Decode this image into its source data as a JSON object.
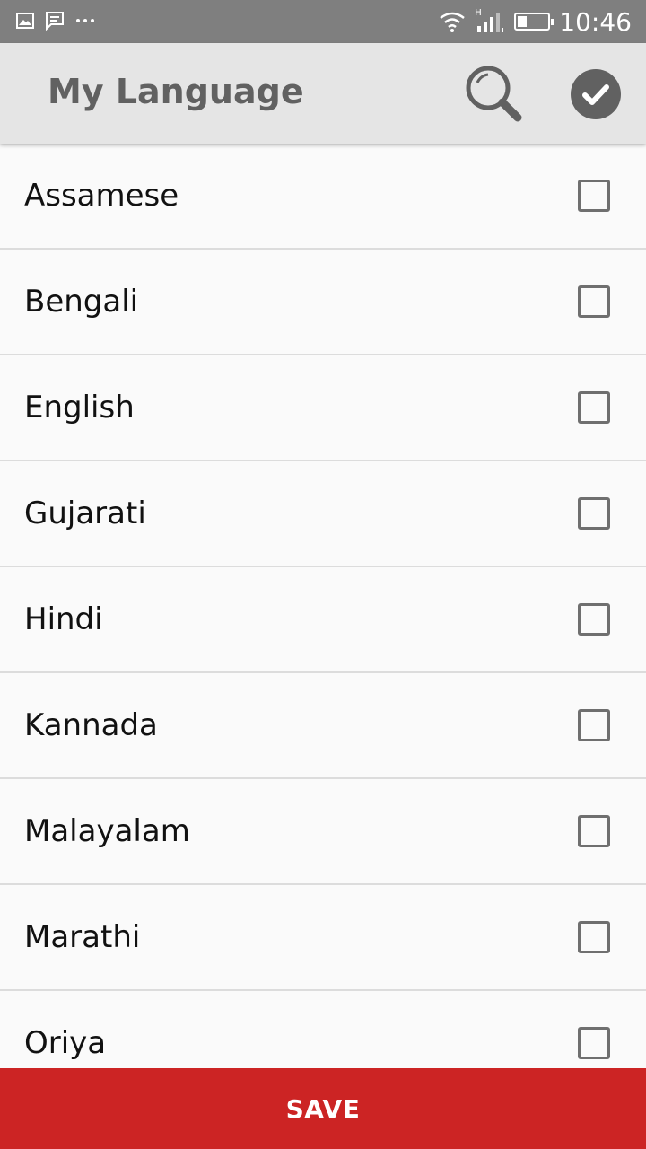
{
  "status_bar": {
    "time": "10:46",
    "icons": [
      "gallery-icon",
      "message-icon",
      "more-dots-icon",
      "wifi-icon",
      "signal-icon",
      "battery-icon"
    ],
    "battery_level": 0.3,
    "network_label": "H"
  },
  "app_bar": {
    "title": "My Language",
    "search_icon": "search-icon",
    "done_icon": "check-circle-icon"
  },
  "languages": [
    {
      "label": "Assamese",
      "checked": false
    },
    {
      "label": "Bengali",
      "checked": false
    },
    {
      "label": "English",
      "checked": false
    },
    {
      "label": "Gujarati",
      "checked": false
    },
    {
      "label": "Hindi",
      "checked": false
    },
    {
      "label": "Kannada",
      "checked": false
    },
    {
      "label": "Malayalam",
      "checked": false
    },
    {
      "label": "Marathi",
      "checked": false
    },
    {
      "label": "Oriya",
      "checked": false
    }
  ],
  "save_bar": {
    "label": "SAVE"
  },
  "colors": {
    "status_bar": "#7f7f7f",
    "app_bar": "#e5e5e5",
    "accent": "#cc2424",
    "icon": "#616161"
  }
}
